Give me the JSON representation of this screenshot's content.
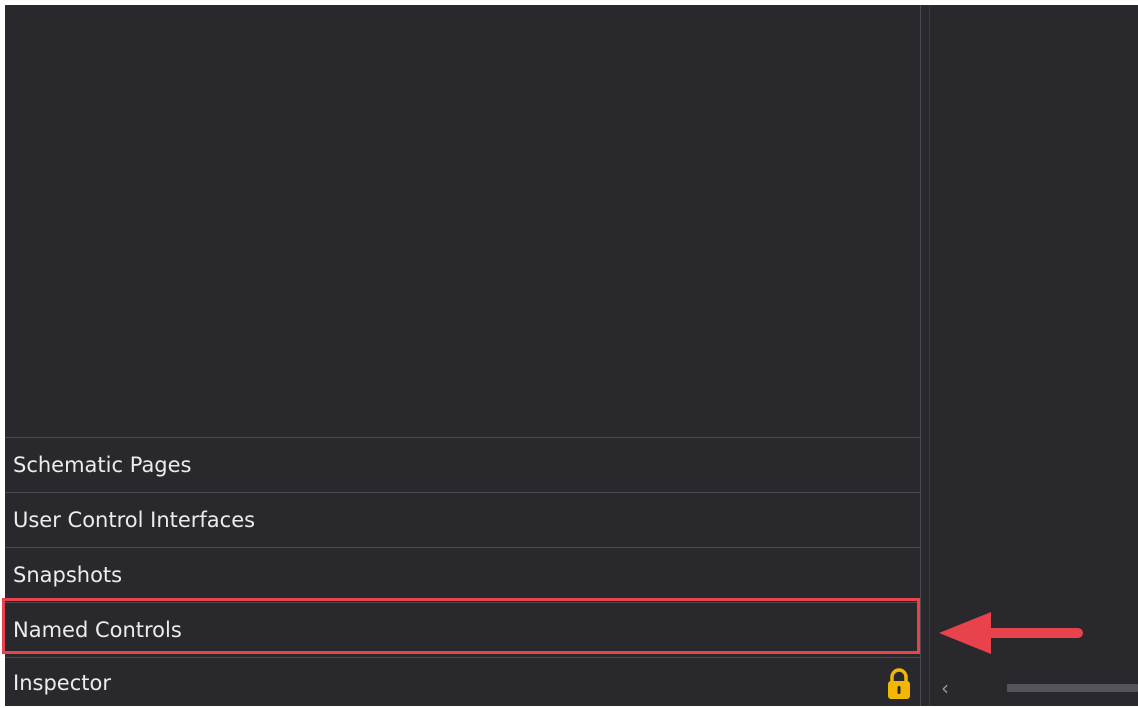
{
  "panel": {
    "items": [
      {
        "label": "Schematic Pages"
      },
      {
        "label": "User Control Interfaces"
      },
      {
        "label": "Snapshots"
      },
      {
        "label": "Named Controls"
      },
      {
        "label": "Inspector"
      }
    ],
    "inspector_icon": "lock-icon"
  },
  "annotation": {
    "highlight_target": "Named Controls",
    "highlight_color": "#e8424d",
    "arrow_icon": "arrow-left-icon"
  },
  "right_panel": {
    "scroll_left_icon": "chevron-left-icon",
    "scroll_left_glyph": "‹"
  },
  "colors": {
    "background": "#28282d",
    "text": "#ececec",
    "lock": "#f2b705",
    "accent": "#e8424d"
  }
}
